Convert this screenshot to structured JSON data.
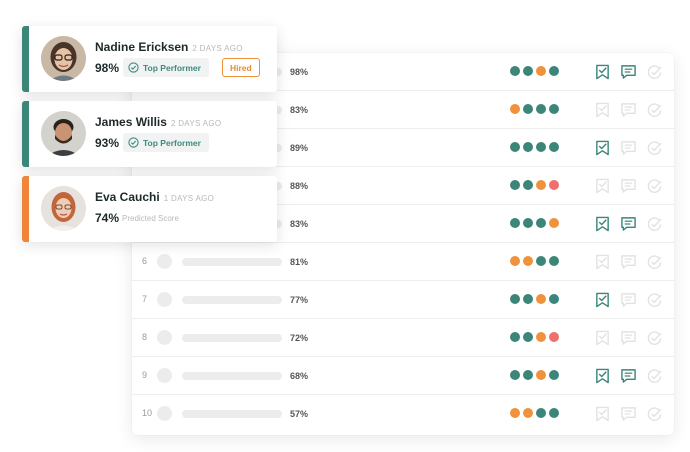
{
  "colors": {
    "green": "#3b8579",
    "orange": "#f0923c",
    "red": "#ee6f6d",
    "accent_green": "#3b8579",
    "accent_orange": "#f0843a",
    "icon_active": "#3b8579",
    "icon_muted": "#e2e2e2"
  },
  "leaderboard": {
    "rows": [
      {
        "rank": "",
        "score": "98%",
        "dots": [
          "green",
          "green",
          "orange",
          "green"
        ],
        "actions": [
          true,
          true,
          false
        ]
      },
      {
        "rank": "",
        "score": "83%",
        "dots": [
          "orange",
          "green",
          "green",
          "green"
        ],
        "actions": [
          false,
          false,
          false
        ]
      },
      {
        "rank": "",
        "score": "89%",
        "dots": [
          "green",
          "green",
          "green",
          "green"
        ],
        "actions": [
          true,
          false,
          false
        ]
      },
      {
        "rank": "",
        "score": "88%",
        "dots": [
          "green",
          "green",
          "orange",
          "red"
        ],
        "actions": [
          false,
          false,
          false
        ]
      },
      {
        "rank": "",
        "score": "83%",
        "dots": [
          "green",
          "green",
          "green",
          "orange"
        ],
        "actions": [
          true,
          true,
          false
        ]
      },
      {
        "rank": "6",
        "score": "81%",
        "dots": [
          "orange",
          "orange",
          "green",
          "green"
        ],
        "actions": [
          false,
          false,
          false
        ]
      },
      {
        "rank": "7",
        "score": "77%",
        "dots": [
          "green",
          "green",
          "orange",
          "green"
        ],
        "actions": [
          true,
          false,
          false
        ]
      },
      {
        "rank": "8",
        "score": "72%",
        "dots": [
          "green",
          "green",
          "orange",
          "red"
        ],
        "actions": [
          false,
          false,
          false
        ]
      },
      {
        "rank": "9",
        "score": "68%",
        "dots": [
          "green",
          "green",
          "orange",
          "green"
        ],
        "actions": [
          true,
          true,
          false
        ]
      },
      {
        "rank": "10",
        "score": "57%",
        "dots": [
          "orange",
          "orange",
          "green",
          "green"
        ],
        "actions": [
          false,
          false,
          false
        ]
      }
    ]
  },
  "cards": [
    {
      "name": "Nadine Ericksen",
      "time": "2 DAYS AGO",
      "score": "98%",
      "badge": "Top Performer",
      "hired": "Hired",
      "accent": "green"
    },
    {
      "name": "James Willis",
      "time": "2 DAYS AGO",
      "score": "93%",
      "badge": "Top Performer",
      "accent": "green"
    },
    {
      "name": "Eva Cauchi",
      "time": "1 DAYS AGO",
      "score": "74%",
      "label": "Predicted Score",
      "accent": "orange"
    }
  ]
}
